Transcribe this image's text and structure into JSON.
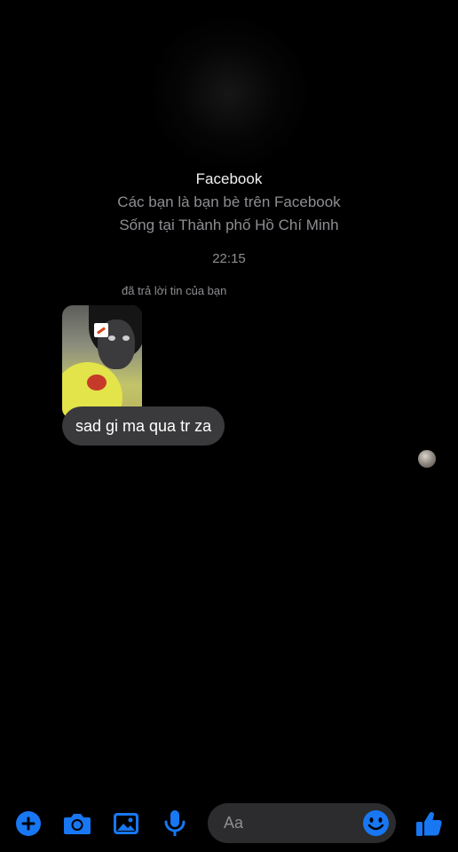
{
  "profile": {
    "name": "Facebook",
    "line1": "Các bạn là bạn bè trên Facebook",
    "line2": "Sống tại Thành phố Hồ Chí Minh"
  },
  "thread": {
    "timestamp": "22:15",
    "reply_note": "đã trả lời tin của bạn",
    "message_text": "sad gi ma qua tr za"
  },
  "composer": {
    "placeholder": "Aa",
    "icons": [
      "plus-icon",
      "camera-icon",
      "image-icon",
      "microphone-icon",
      "emoji-icon",
      "thumbs-up-icon"
    ],
    "accent_color": "#1877f2"
  },
  "colors": {
    "background": "#000000",
    "bubble": "#3a3a3c",
    "secondary_text": "#8e8e93"
  }
}
